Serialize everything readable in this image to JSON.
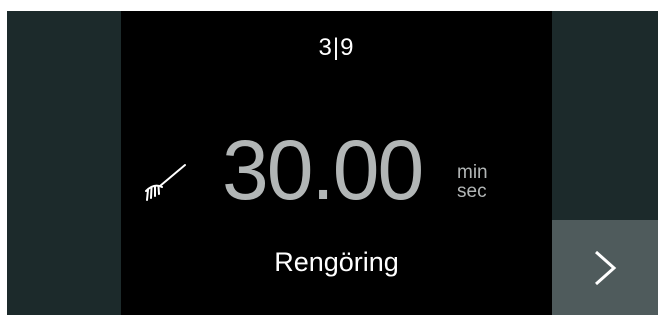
{
  "display": {
    "step_counter": "3|9",
    "timer_value": "30.00",
    "unit_min": "min",
    "unit_sec": "sec",
    "program_name": "Rengöring"
  },
  "icons": {
    "program_icon": "brush-icon",
    "next_icon": "chevron-right-icon"
  },
  "colors": {
    "side_panel": "#1c2a2b",
    "center_panel": "#000000",
    "next_button": "#4f5b5c",
    "timer_text": "#b2b6b6",
    "primary_text": "#ffffff"
  }
}
